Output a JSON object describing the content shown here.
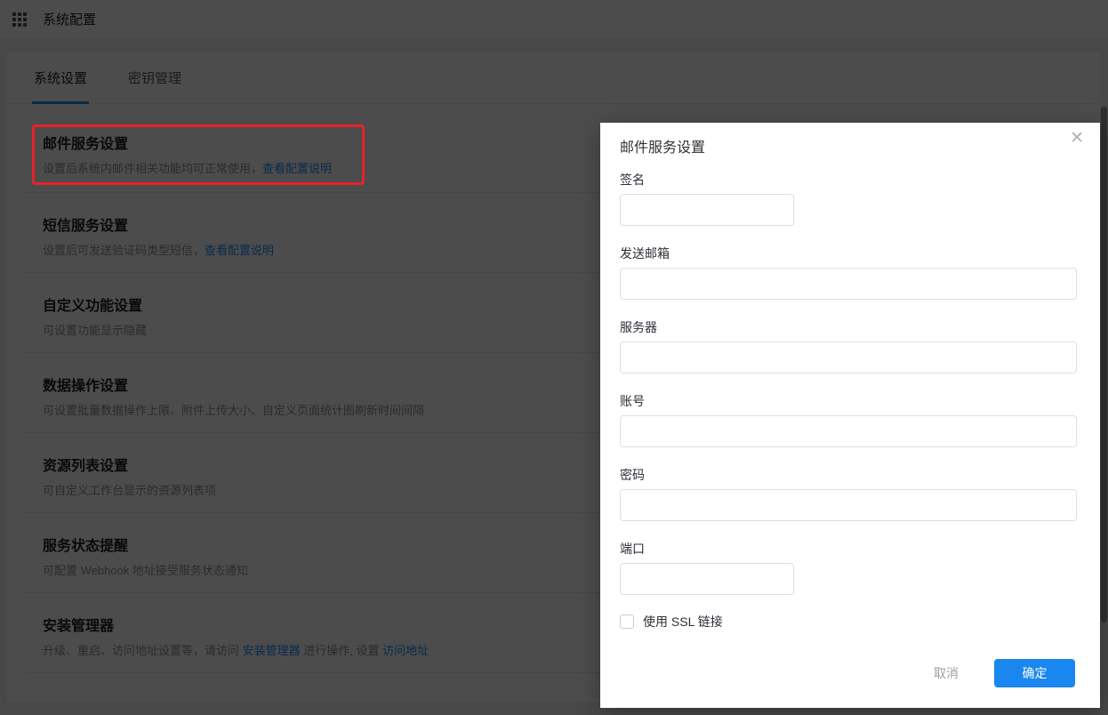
{
  "header": {
    "title": "系统配置"
  },
  "tabs": [
    {
      "label": "系统设置",
      "active": true
    },
    {
      "label": "密钥管理",
      "active": false
    }
  ],
  "sections": [
    {
      "title": "邮件服务设置",
      "desc": "设置后系统内邮件相关功能均可正常使用，",
      "link": "查看配置说明",
      "highlighted": true
    },
    {
      "title": "短信服务设置",
      "desc": "设置后可发送验证码类型短信，",
      "link": "查看配置说明"
    },
    {
      "title": "自定义功能设置",
      "desc": "可设置功能显示隐藏"
    },
    {
      "title": "数据操作设置",
      "desc": "可设置批量数据操作上限、附件上传大小、自定义页面统计图刷新时间间隔"
    },
    {
      "title": "资源列表设置",
      "desc": "可自定义工作台显示的资源列表项"
    },
    {
      "title": "服务状态提醒",
      "desc": "可配置 Webhook 地址接受服务状态通知"
    },
    {
      "title": "安装管理器",
      "parts": [
        "升级、重启、访问地址设置等，请访问 ",
        "安装管理器",
        " 进行操作, 设置 ",
        "访问地址"
      ]
    }
  ],
  "modal": {
    "title": "邮件服务设置",
    "close_icon": "✕",
    "fields": [
      {
        "label": "签名",
        "value": "",
        "width": "short"
      },
      {
        "label": "发送邮箱",
        "value": "",
        "width": "full"
      },
      {
        "label": "服务器",
        "value": "",
        "width": "full"
      },
      {
        "label": "账号",
        "value": "",
        "width": "full"
      },
      {
        "label": "密码",
        "value": "",
        "width": "full"
      },
      {
        "label": "端口",
        "value": "",
        "width": "short"
      }
    ],
    "checkbox": {
      "label": "使用 SSL 链接",
      "checked": false
    },
    "cancel_label": "取消",
    "confirm_label": "确定"
  },
  "colors": {
    "primary_button": "#1a86f0",
    "link": "#1890ff",
    "tab_underline": "#1890ff",
    "highlight_border": "#e8222a",
    "mask": "rgba(0,0,0,0.70)"
  }
}
